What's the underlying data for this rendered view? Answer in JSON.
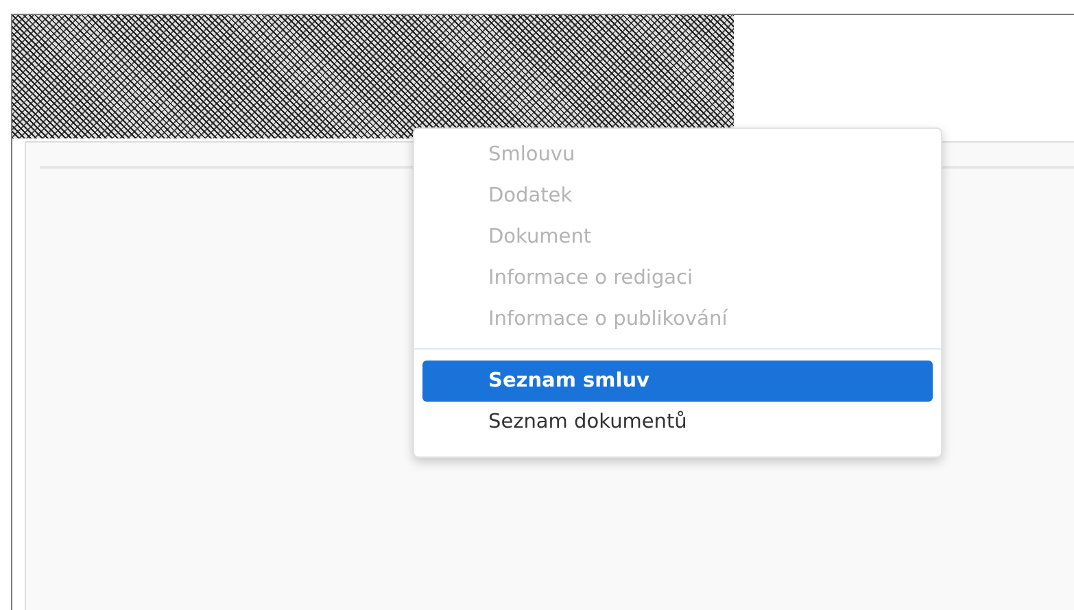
{
  "menu": {
    "items": [
      {
        "kind": "item",
        "label": "Smlouvu",
        "disabled": true,
        "selected": false
      },
      {
        "kind": "item",
        "label": "Dodatek",
        "disabled": true,
        "selected": false
      },
      {
        "kind": "item",
        "label": "Dokument",
        "disabled": true,
        "selected": false
      },
      {
        "kind": "item",
        "label": "Informace o redigaci",
        "disabled": true,
        "selected": false
      },
      {
        "kind": "item",
        "label": "Informace o publikování",
        "disabled": true,
        "selected": false
      },
      {
        "kind": "separator"
      },
      {
        "kind": "item",
        "label": "Seznam smluv",
        "disabled": false,
        "selected": true
      },
      {
        "kind": "item",
        "label": "Seznam dokumentů",
        "disabled": false,
        "selected": false
      }
    ]
  }
}
